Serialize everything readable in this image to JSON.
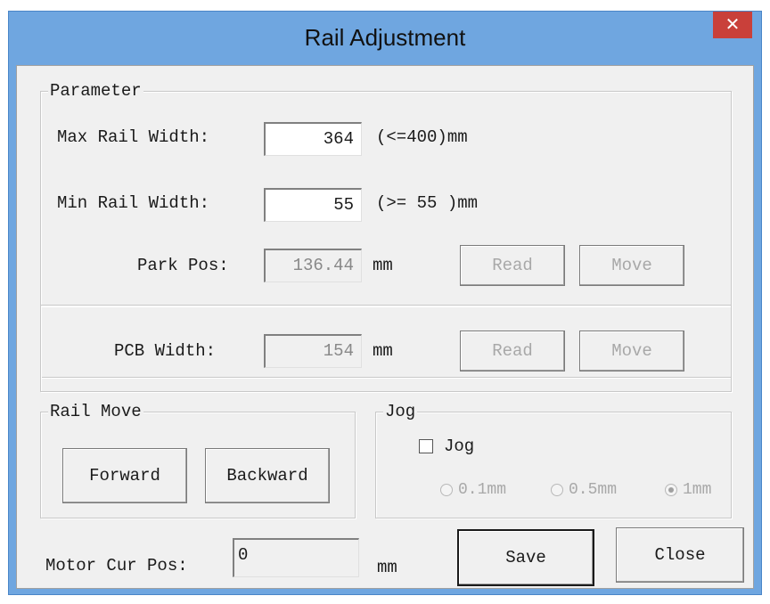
{
  "window": {
    "title": "Rail Adjustment",
    "close_glyph": "✕"
  },
  "parameter": {
    "legend": "Parameter",
    "max_width_label": "Max Rail Width:",
    "max_width_value": "364",
    "max_width_hint": "(<=400)mm",
    "min_width_label": "Min Rail Width:",
    "min_width_value": "55",
    "min_width_hint": "(>= 55 )mm",
    "park_label": "Park Pos:",
    "park_value": "136.44",
    "park_unit": "mm",
    "read_label": "Read",
    "move_label": "Move",
    "pcb_label": "PCB Width:",
    "pcb_value": "154",
    "pcb_unit": "mm"
  },
  "rail_move": {
    "legend": "Rail Move",
    "forward_label": "Forward",
    "backward_label": "Backward"
  },
  "jog": {
    "legend": "Jog",
    "checkbox_label": "Jog",
    "checked": false,
    "options": [
      {
        "label": "0.1mm",
        "selected": false
      },
      {
        "label": "0.5mm",
        "selected": false
      },
      {
        "label": "1mm",
        "selected": true
      }
    ]
  },
  "motor": {
    "label": "Motor Cur Pos:",
    "value": "0",
    "unit": "mm"
  },
  "footer": {
    "save_label": "Save",
    "close_label": "Close"
  }
}
